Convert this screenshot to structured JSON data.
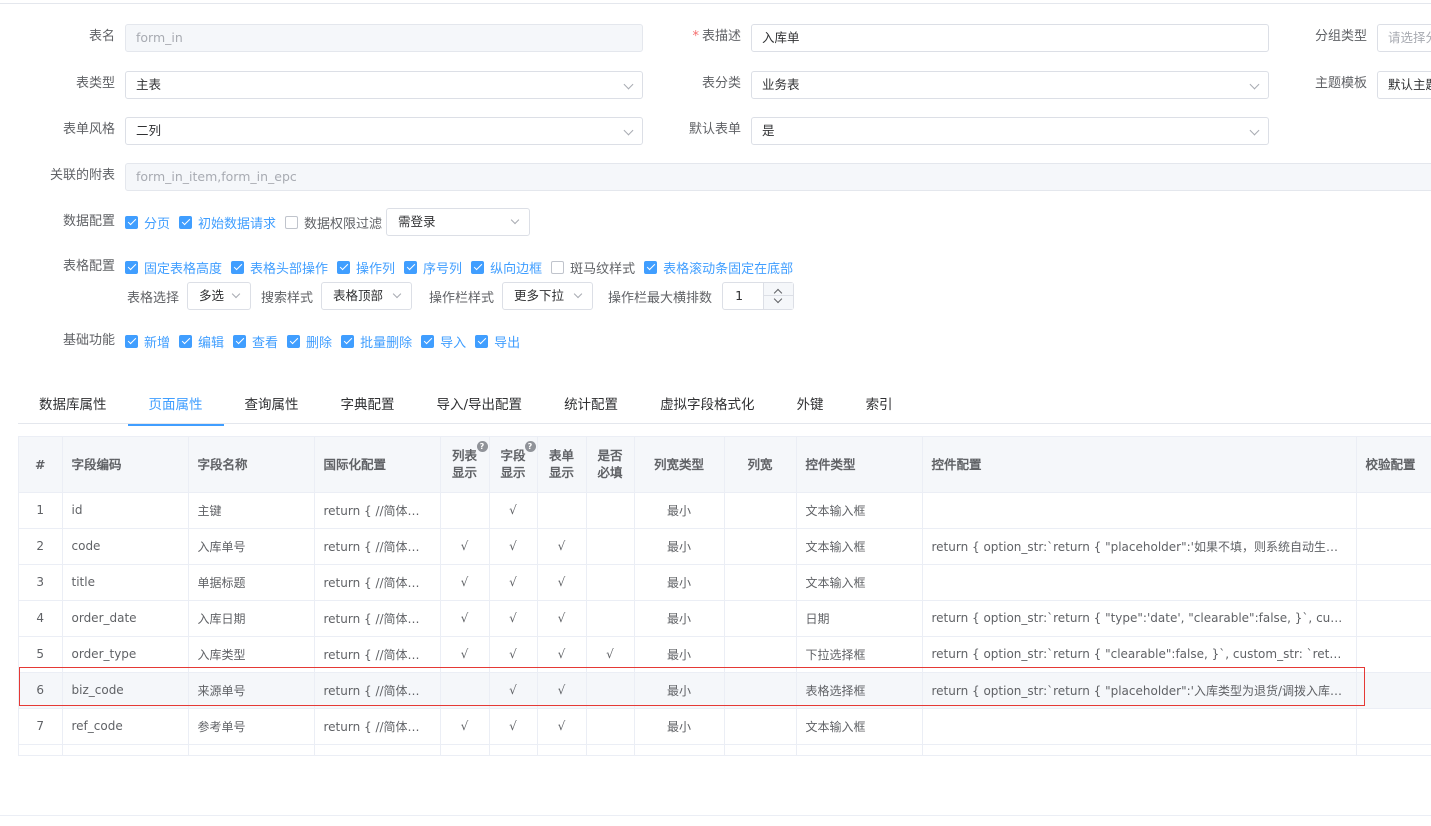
{
  "form": {
    "table_name_label": "表名",
    "table_name_value": "form_in",
    "table_desc_label": "表描述",
    "table_desc_required": "*",
    "table_desc_value": "入库单",
    "group_type_label": "分组类型",
    "group_type_placeholder": "请选择分",
    "table_type_label": "表类型",
    "table_type_value": "主表",
    "table_category_label": "表分类",
    "table_category_value": "业务表",
    "theme_label": "主题模板",
    "theme_value": "默认主题",
    "form_style_label": "表单风格",
    "form_style_value": "二列",
    "default_form_label": "默认表单",
    "default_form_value": "是",
    "sub_tables_label": "关联的附表",
    "sub_tables_value": "form_in_item,form_in_epc"
  },
  "data_config": {
    "label": "数据配置",
    "options": [
      {
        "text": "分页",
        "checked": true
      },
      {
        "text": "初始数据请求",
        "checked": true
      },
      {
        "text": "数据权限过滤",
        "checked": false
      }
    ],
    "login_select": "需登录"
  },
  "table_config": {
    "label": "表格配置",
    "options": [
      {
        "text": "固定表格高度",
        "checked": true
      },
      {
        "text": "表格头部操作",
        "checked": true
      },
      {
        "text": "操作列",
        "checked": true
      },
      {
        "text": "序号列",
        "checked": true
      },
      {
        "text": "纵向边框",
        "checked": true
      },
      {
        "text": "斑马纹样式",
        "checked": false
      },
      {
        "text": "表格滚动条固定在底部",
        "checked": true
      }
    ],
    "select_label": "表格选择",
    "select_value": "多选",
    "search_style_label": "搜索样式",
    "search_style_value": "表格顶部",
    "action_style_label": "操作栏样式",
    "action_style_value": "更多下拉",
    "max_actions_label": "操作栏最大横排数",
    "max_actions_value": "1"
  },
  "basic_functions": {
    "label": "基础功能",
    "options": [
      {
        "text": "新增",
        "checked": true
      },
      {
        "text": "编辑",
        "checked": true
      },
      {
        "text": "查看",
        "checked": true
      },
      {
        "text": "删除",
        "checked": true
      },
      {
        "text": "批量删除",
        "checked": true
      },
      {
        "text": "导入",
        "checked": true
      },
      {
        "text": "导出",
        "checked": true
      }
    ]
  },
  "tabs": [
    {
      "label": "数据库属性",
      "active": false
    },
    {
      "label": "页面属性",
      "active": true
    },
    {
      "label": "查询属性",
      "active": false
    },
    {
      "label": "字典配置",
      "active": false
    },
    {
      "label": "导入/导出配置",
      "active": false
    },
    {
      "label": "统计配置",
      "active": false
    },
    {
      "label": "虚拟字段格式化",
      "active": false
    },
    {
      "label": "外键",
      "active": false
    },
    {
      "label": "索引",
      "active": false
    }
  ],
  "table": {
    "headers": {
      "idx": "#",
      "code": "字段编码",
      "name": "字段名称",
      "i18n": "国际化配置",
      "list_show_1": "列表",
      "list_show_2": "显示",
      "field_show_1": "字段",
      "field_show_2": "显示",
      "form_show_1": "表单",
      "form_show_2": "显示",
      "required_1": "是否",
      "required_2": "必填",
      "width_type": "列宽类型",
      "width": "列宽",
      "ctrl_type": "控件类型",
      "ctrl_conf": "控件配置",
      "validate": "校验配置",
      "help": "?"
    },
    "rows": [
      {
        "idx": "1",
        "code": "id",
        "name": "主键",
        "i18n": "return { //简体中文...",
        "list": "",
        "field": "√",
        "form": "",
        "req": "",
        "wtype": "最小",
        "width": "",
        "ctrl": "文本输入框",
        "conf": ""
      },
      {
        "idx": "2",
        "code": "code",
        "name": "入库单号",
        "i18n": "return { //简体中文...",
        "list": "√",
        "field": "√",
        "form": "√",
        "req": "",
        "wtype": "最小",
        "width": "",
        "ctrl": "文本输入框",
        "conf": "return { option_str:`return { \"placeholder\":'如果不填，则系统自动生成', }`, custo..."
      },
      {
        "idx": "3",
        "code": "title",
        "name": "单据标题",
        "i18n": "return { //简体中文...",
        "list": "√",
        "field": "√",
        "form": "√",
        "req": "",
        "wtype": "最小",
        "width": "",
        "ctrl": "文本输入框",
        "conf": ""
      },
      {
        "idx": "4",
        "code": "order_date",
        "name": "入库日期",
        "i18n": "return { //简体中文...",
        "list": "√",
        "field": "√",
        "form": "√",
        "req": "",
        "wtype": "最小",
        "width": "",
        "ctrl": "日期",
        "conf": "return { option_str:`return { \"type\":'date', \"clearable\":false, }`, custom_str: `return..."
      },
      {
        "idx": "5",
        "code": "order_type",
        "name": "入库类型",
        "i18n": "return { //简体中文...",
        "list": "√",
        "field": "√",
        "form": "√",
        "req": "√",
        "wtype": "最小",
        "width": "",
        "ctrl": "下拉选择框",
        "conf": "return { option_str:`return { \"clearable\":false, }`, custom_str: `return { }`, }"
      },
      {
        "idx": "6",
        "code": "biz_code",
        "name": "来源单号",
        "i18n": "return { //简体中文...",
        "list": "",
        "field": "√",
        "form": "√",
        "req": "",
        "wtype": "最小",
        "width": "",
        "ctrl": "表格选择框",
        "conf": "return { option_str:`return { \"placeholder\":'入库类型为退货/调拨入库时必填', \"cl..."
      },
      {
        "idx": "7",
        "code": "ref_code",
        "name": "参考单号",
        "i18n": "return { //简体中文...",
        "list": "√",
        "field": "√",
        "form": "√",
        "req": "",
        "wtype": "最小",
        "width": "",
        "ctrl": "文本输入框",
        "conf": ""
      }
    ]
  }
}
